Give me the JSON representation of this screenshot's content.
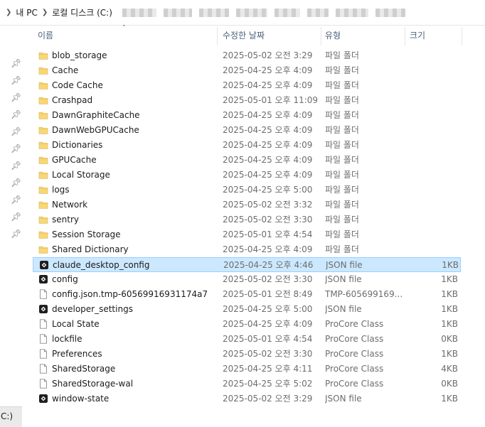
{
  "breadcrumb": {
    "items": [
      "내 PC",
      "로컬 디스크 (C:)"
    ]
  },
  "left_pane": {
    "bottom_label": "C:)"
  },
  "columns": {
    "name": "이름",
    "date": "수정한 날짜",
    "type": "유형",
    "size": "크기"
  },
  "colors": {
    "folder": "#f8d775",
    "selection": "#cce8ff",
    "selection_border": "#99d1ff"
  },
  "files": [
    {
      "name": "blob_storage",
      "date": "2025-05-02 오전 3:29",
      "type": "파일 폴더",
      "size": "",
      "icon": "folder-icon"
    },
    {
      "name": "Cache",
      "date": "2025-04-25 오후 4:09",
      "type": "파일 폴더",
      "size": "",
      "icon": "folder-icon"
    },
    {
      "name": "Code Cache",
      "date": "2025-04-25 오후 4:09",
      "type": "파일 폴더",
      "size": "",
      "icon": "folder-icon"
    },
    {
      "name": "Crashpad",
      "date": "2025-05-01 오후 11:09",
      "type": "파일 폴더",
      "size": "",
      "icon": "folder-icon"
    },
    {
      "name": "DawnGraphiteCache",
      "date": "2025-04-25 오후 4:09",
      "type": "파일 폴더",
      "size": "",
      "icon": "folder-icon"
    },
    {
      "name": "DawnWebGPUCache",
      "date": "2025-04-25 오후 4:09",
      "type": "파일 폴더",
      "size": "",
      "icon": "folder-icon"
    },
    {
      "name": "Dictionaries",
      "date": "2025-04-25 오후 4:09",
      "type": "파일 폴더",
      "size": "",
      "icon": "folder-icon"
    },
    {
      "name": "GPUCache",
      "date": "2025-04-25 오후 4:09",
      "type": "파일 폴더",
      "size": "",
      "icon": "folder-icon"
    },
    {
      "name": "Local Storage",
      "date": "2025-04-25 오후 4:09",
      "type": "파일 폴더",
      "size": "",
      "icon": "folder-icon"
    },
    {
      "name": "logs",
      "date": "2025-04-25 오후 5:00",
      "type": "파일 폴더",
      "size": "",
      "icon": "folder-icon"
    },
    {
      "name": "Network",
      "date": "2025-05-02 오전 3:32",
      "type": "파일 폴더",
      "size": "",
      "icon": "folder-icon"
    },
    {
      "name": "sentry",
      "date": "2025-05-02 오전 3:30",
      "type": "파일 폴더",
      "size": "",
      "icon": "folder-icon"
    },
    {
      "name": "Session Storage",
      "date": "2025-05-01 오후 4:54",
      "type": "파일 폴더",
      "size": "",
      "icon": "folder-icon"
    },
    {
      "name": "Shared Dictionary",
      "date": "2025-04-25 오후 4:09",
      "type": "파일 폴더",
      "size": "",
      "icon": "folder-icon"
    },
    {
      "name": "claude_desktop_config",
      "date": "2025-04-25 오후 4:46",
      "type": "JSON file",
      "size": "1KB",
      "icon": "json-file-icon",
      "selected": true
    },
    {
      "name": "config",
      "date": "2025-05-02 오전 3:30",
      "type": "JSON file",
      "size": "1KB",
      "icon": "json-file-icon"
    },
    {
      "name": "config.json.tmp-60569916931174a7",
      "date": "2025-05-01 오전 8:49",
      "type": "TMP-605699169...",
      "size": "1KB",
      "icon": "file-icon"
    },
    {
      "name": "developer_settings",
      "date": "2025-04-25 오후 5:00",
      "type": "JSON file",
      "size": "1KB",
      "icon": "json-file-icon"
    },
    {
      "name": "Local State",
      "date": "2025-04-25 오후 4:09",
      "type": "ProCore Class",
      "size": "1KB",
      "icon": "file-icon"
    },
    {
      "name": "lockfile",
      "date": "2025-05-01 오후 4:54",
      "type": "ProCore Class",
      "size": "0KB",
      "icon": "file-icon"
    },
    {
      "name": "Preferences",
      "date": "2025-05-02 오전 3:30",
      "type": "ProCore Class",
      "size": "1KB",
      "icon": "file-icon"
    },
    {
      "name": "SharedStorage",
      "date": "2025-04-25 오후 4:11",
      "type": "ProCore Class",
      "size": "4KB",
      "icon": "file-icon"
    },
    {
      "name": "SharedStorage-wal",
      "date": "2025-04-25 오후 5:02",
      "type": "ProCore Class",
      "size": "0KB",
      "icon": "file-icon"
    },
    {
      "name": "window-state",
      "date": "2025-05-02 오전 3:29",
      "type": "JSON file",
      "size": "1KB",
      "icon": "json-file-icon"
    }
  ]
}
